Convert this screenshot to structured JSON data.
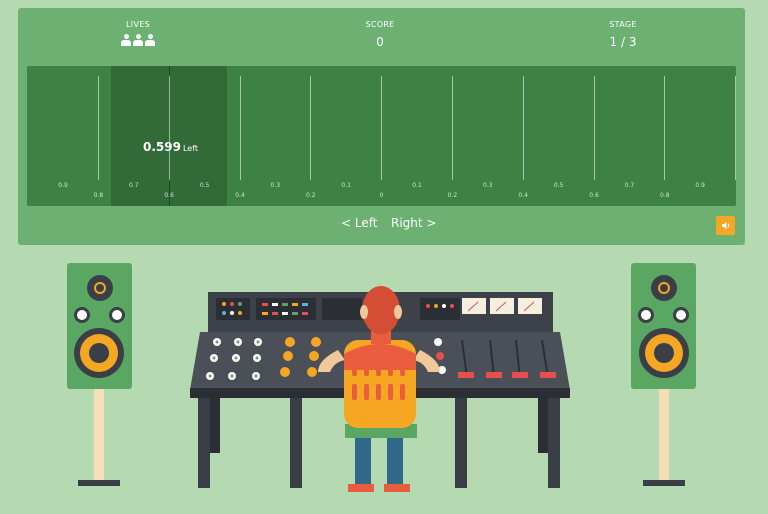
{
  "hud": {
    "lives": {
      "label": "LIVES",
      "count": 3
    },
    "score": {
      "label": "SCORE",
      "value": "0"
    },
    "stage": {
      "label": "STAGE",
      "value": "1 / 3"
    }
  },
  "slider": {
    "readout_value": "0.599",
    "readout_direction": "Left",
    "ticks": [
      {
        "label": "0.9",
        "row": "high"
      },
      {
        "label": "0.8",
        "row": "low"
      },
      {
        "label": "0.7",
        "row": "high"
      },
      {
        "label": "0.6",
        "row": "low"
      },
      {
        "label": "0.5",
        "row": "high"
      },
      {
        "label": "0.4",
        "row": "low"
      },
      {
        "label": "0.3",
        "row": "high"
      },
      {
        "label": "0.2",
        "row": "low"
      },
      {
        "label": "0.1",
        "row": "high"
      },
      {
        "label": "0",
        "row": "low"
      },
      {
        "label": "0.1",
        "row": "high"
      },
      {
        "label": "0.2",
        "row": "low"
      },
      {
        "label": "0.3",
        "row": "high"
      },
      {
        "label": "0.4",
        "row": "low"
      },
      {
        "label": "0.5",
        "row": "high"
      },
      {
        "label": "0.6",
        "row": "low"
      },
      {
        "label": "0.7",
        "row": "high"
      },
      {
        "label": "0.8",
        "row": "low"
      },
      {
        "label": "0.9",
        "row": "high"
      }
    ]
  },
  "controls": {
    "left_label": "< Left",
    "right_label": "Right >",
    "sound_icon": "speaker-icon"
  },
  "colors": {
    "background": "#b5d9b0",
    "panel": "#6cb072",
    "track": "#3e8145",
    "highlight": "#326b38",
    "accent": "#f5a623"
  }
}
